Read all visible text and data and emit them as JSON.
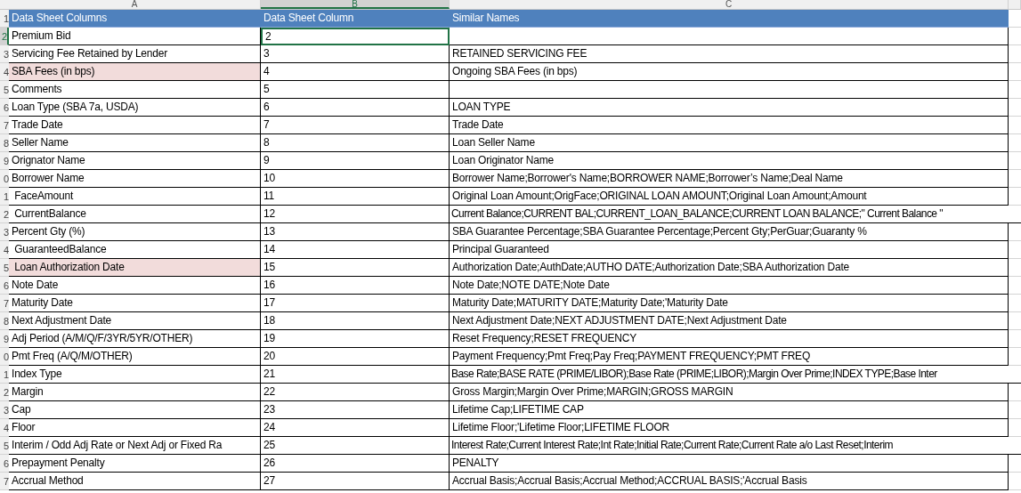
{
  "columns": [
    {
      "letter": "A",
      "selected": false
    },
    {
      "letter": "B",
      "selected": true
    },
    {
      "letter": "C",
      "selected": false
    }
  ],
  "header": {
    "row_number": "1",
    "name": "Data Sheet Columns",
    "index": "Data Sheet Column",
    "similar": "Similar Names"
  },
  "rows": [
    {
      "row_number": "2",
      "name": "Premium Bid",
      "index": "2",
      "similar": "",
      "highlighted": false,
      "selected": true,
      "overflow": false
    },
    {
      "row_number": "3",
      "name": "Servicing Fee Retained by Lender",
      "index": "3",
      "similar": "RETAINED SERVICING FEE",
      "highlighted": false,
      "selected": false,
      "overflow": false
    },
    {
      "row_number": "4",
      "name": "SBA Fees (in bps)",
      "index": "4",
      "similar": "Ongoing SBA Fees (in bps)",
      "highlighted": true,
      "selected": false,
      "overflow": false
    },
    {
      "row_number": "5",
      "name": "Comments",
      "index": "5",
      "similar": "",
      "highlighted": false,
      "selected": false,
      "overflow": false
    },
    {
      "row_number": "6",
      "name": "Loan Type (SBA 7a, USDA)",
      "index": "6",
      "similar": "LOAN TYPE",
      "highlighted": false,
      "selected": false,
      "overflow": false
    },
    {
      "row_number": "7",
      "name": "Trade Date",
      "index": "7",
      "similar": "Trade Date",
      "highlighted": false,
      "selected": false,
      "overflow": false
    },
    {
      "row_number": "8",
      "name": "Seller Name",
      "index": "8",
      "similar": "Loan Seller Name",
      "highlighted": false,
      "selected": false,
      "overflow": false
    },
    {
      "row_number": "9",
      "name": "Orignator Name",
      "index": "9",
      "similar": "Loan Originator Name",
      "highlighted": false,
      "selected": false,
      "overflow": false
    },
    {
      "row_number": "0",
      "name": "Borrower Name",
      "index": "10",
      "similar": "Borrower Name;Borrower's Name;BORROWER NAME;Borrower’s Name;Deal Name",
      "highlighted": false,
      "selected": false,
      "overflow": false
    },
    {
      "row_number": "1",
      "name": " FaceAmount",
      "index": "11",
      "similar": "Original Loan Amount;OrigFace;ORIGINAL LOAN AMOUNT;Original Loan Amount;Amount",
      "highlighted": false,
      "selected": false,
      "overflow": false
    },
    {
      "row_number": "2",
      "name": " CurrentBalance",
      "index": "12",
      "similar": "Current Balance;CURRENT BAL;CURRENT_LOAN_BALANCE;CURRENT LOAN BALANCE;\" Current Balance \"",
      "highlighted": false,
      "selected": false,
      "overflow": true
    },
    {
      "row_number": "3",
      "name": "Percent Gty (%)",
      "index": "13",
      "similar": "SBA Guarantee Percentage;SBA Guarantee Percentage;Percent Gty;PerGuar;Guaranty %",
      "highlighted": false,
      "selected": false,
      "overflow": false
    },
    {
      "row_number": "4",
      "name": " GuaranteedBalance",
      "index": "14",
      "similar": "Principal Guaranteed",
      "highlighted": false,
      "selected": false,
      "overflow": false
    },
    {
      "row_number": "5",
      "name": " Loan Authorization Date",
      "index": "15",
      "similar": "Authorization Date;AuthDate;AUTHO DATE;Authorization Date;SBA Authorization Date",
      "highlighted": true,
      "selected": false,
      "overflow": false
    },
    {
      "row_number": "6",
      "name": "Note Date",
      "index": "16",
      "similar": "Note Date;NOTE DATE;Note Date",
      "highlighted": false,
      "selected": false,
      "overflow": false
    },
    {
      "row_number": "7",
      "name": "Maturity Date",
      "index": "17",
      "similar": "Maturity Date;MATURITY DATE;Maturity Date;'Maturity Date",
      "highlighted": false,
      "selected": false,
      "overflow": false
    },
    {
      "row_number": "8",
      "name": "Next Adjustment Date",
      "index": "18",
      "similar": "Next Adjustment Date;NEXT ADJUSTMENT DATE;Next Adjustment Date",
      "highlighted": false,
      "selected": false,
      "overflow": false
    },
    {
      "row_number": "9",
      "name": "Adj Period (A/M/Q/F/3YR/5YR/OTHER)",
      "index": "19",
      "similar": "Reset Frequency;RESET FREQUENCY",
      "highlighted": false,
      "selected": false,
      "overflow": false
    },
    {
      "row_number": "0",
      "name": "Pmt Freq (A/Q/M/OTHER)",
      "index": "20",
      "similar": "Payment Frequency;Pmt Freq;Pay Freq;PAYMENT FREQUENCY;PMT FREQ",
      "highlighted": false,
      "selected": false,
      "overflow": false
    },
    {
      "row_number": "1",
      "name": "Index Type",
      "index": "21",
      "similar": "Base Rate;BASE RATE (PRIME/LIBOR);Base Rate (PRIME;LIBOR);Margin Over Prime;INDEX TYPE;Base Inter",
      "highlighted": false,
      "selected": false,
      "overflow": true
    },
    {
      "row_number": "2",
      "name": "Margin",
      "index": "22",
      "similar": "Gross Margin;Margin Over Prime;MARGIN;GROSS MARGIN",
      "highlighted": false,
      "selected": false,
      "overflow": false
    },
    {
      "row_number": "3",
      "name": "Cap",
      "index": "23",
      "similar": "Lifetime Cap;LIFETIME CAP",
      "highlighted": false,
      "selected": false,
      "overflow": false
    },
    {
      "row_number": "4",
      "name": "Floor",
      "index": "24",
      "similar": "Lifetime Floor;'Lifetime Floor;LIFETIME FLOOR",
      "highlighted": false,
      "selected": false,
      "overflow": false
    },
    {
      "row_number": "5",
      "name": "Interim / Odd Adj Rate or Next Adj or Fixed Ra",
      "index": "25",
      "similar": "Interest Rate;Current Interest Rate;Int Rate;Initial Rate;Current Rate;Current Rate a/o Last Reset;Interim",
      "highlighted": false,
      "selected": false,
      "overflow": true
    },
    {
      "row_number": "6",
      "name": "Prepayment Penalty",
      "index": "26",
      "similar": "PENALTY",
      "highlighted": false,
      "selected": false,
      "overflow": false
    },
    {
      "row_number": "7",
      "name": "Accrual Method",
      "index": "27",
      "similar": "Accrual Basis;Accrual Basis;Accrual Method;ACCRUAL BASIS;'Accrual Basis",
      "highlighted": false,
      "selected": false,
      "overflow": false
    }
  ]
}
